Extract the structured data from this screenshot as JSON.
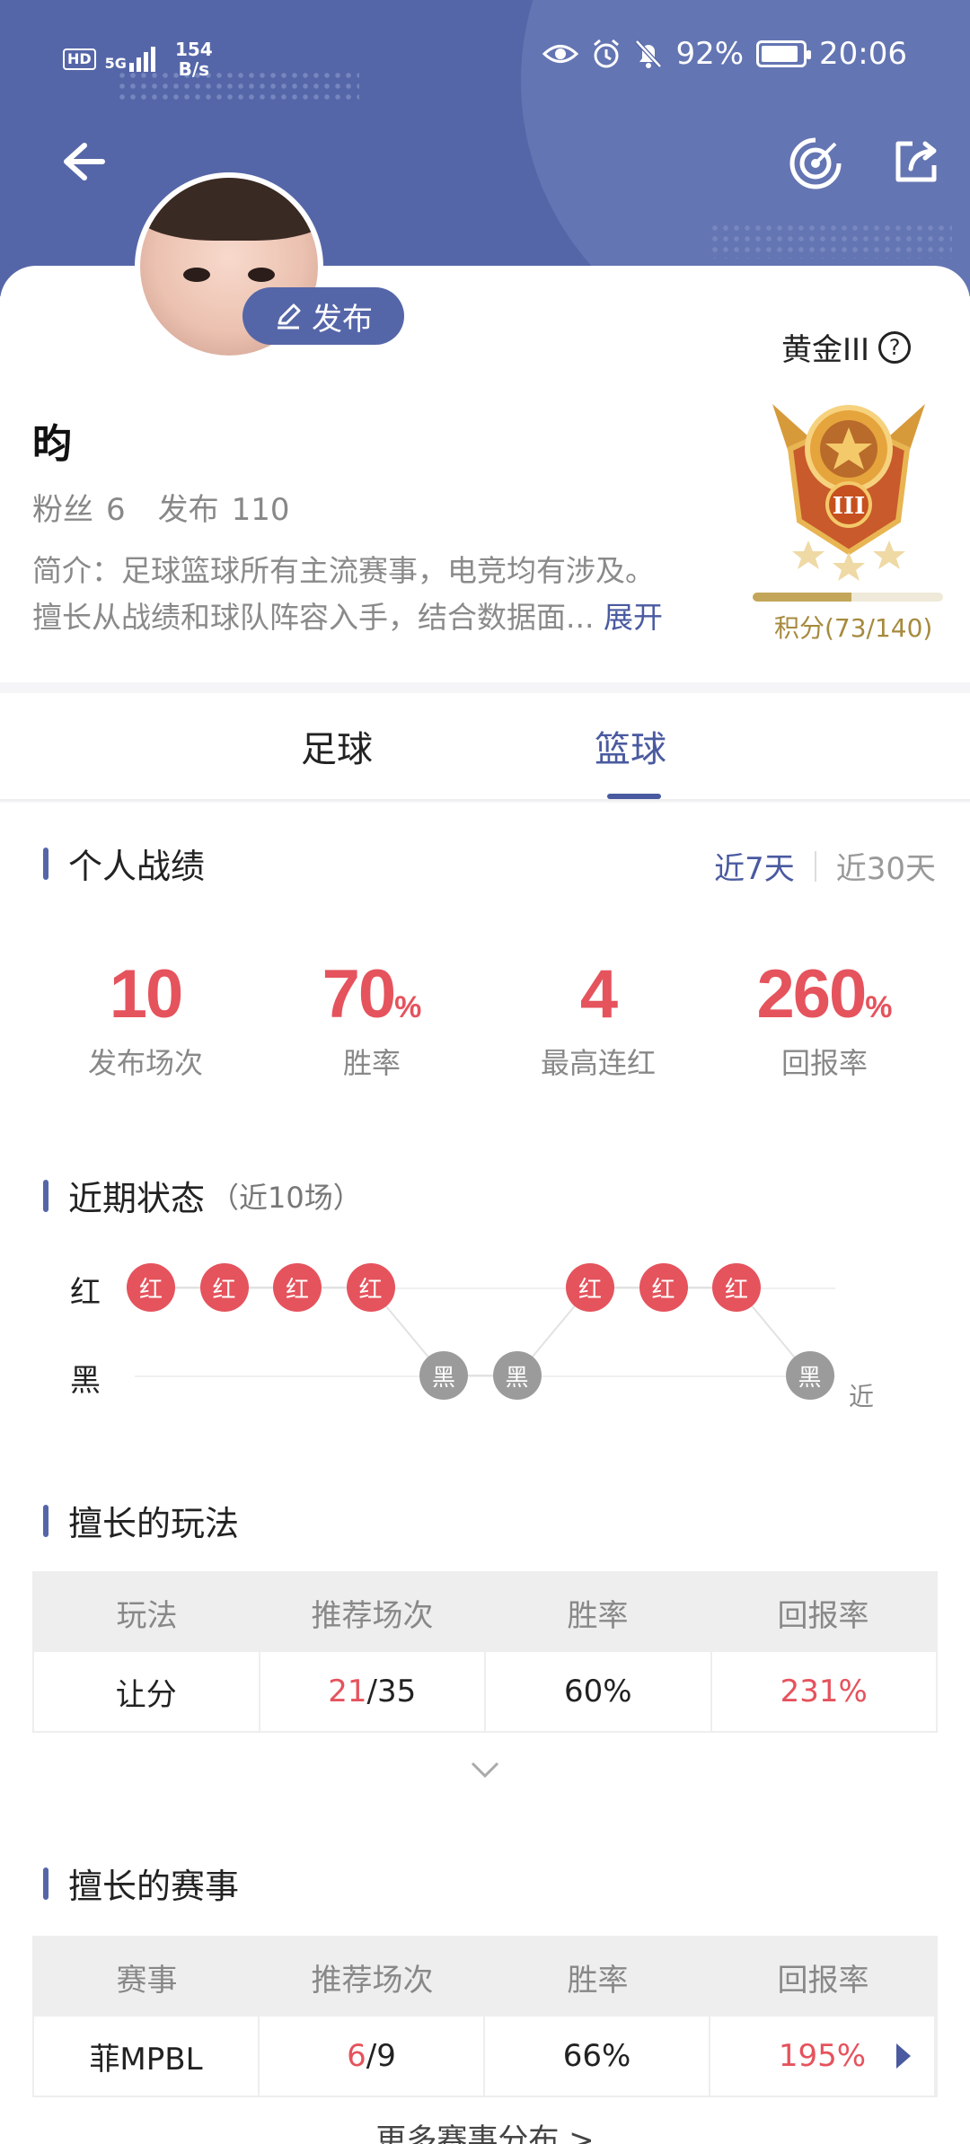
{
  "status_bar": {
    "network_left": "HD",
    "signal": "5G",
    "speed_value": "154",
    "speed_unit": "B/s",
    "battery_percent": "92%",
    "battery_level": 0.92,
    "time": "20:06"
  },
  "profile": {
    "publish_label": "发布",
    "name": "昀",
    "fans_label": "粉丝",
    "fans_count": "6",
    "posts_label": "发布",
    "posts_count": "110",
    "intro_line1": "简介：足球篮球所有主流赛事，电竞均有涉及。",
    "intro_line2": "擅长从战绩和球队阵容入手，结合数据面...",
    "expand_label": "展开",
    "rank_title": "黄金III",
    "help_icon": "?",
    "medal_numeral": "III",
    "score_text": "积分(73/140)",
    "score_fraction": 0.52
  },
  "tabs": [
    {
      "label": "足球"
    },
    {
      "label": "篮球"
    }
  ],
  "record": {
    "title": "个人战绩",
    "range_7": "近7天",
    "range_30": "近30天",
    "metrics": [
      {
        "value": "10",
        "unit": "",
        "label": "发布场次"
      },
      {
        "value": "70",
        "unit": "%",
        "label": "胜率"
      },
      {
        "value": "4",
        "unit": "",
        "label": "最高连红"
      },
      {
        "value": "260",
        "unit": "%",
        "label": "回报率"
      }
    ]
  },
  "recent": {
    "title": "近期状态",
    "subtitle": "（近10场）",
    "row_red": "红",
    "row_black": "黑",
    "near_label": "近",
    "results": [
      "红",
      "红",
      "红",
      "红",
      "黑",
      "黑",
      "红",
      "红",
      "红",
      "黑"
    ]
  },
  "plays": {
    "title": "擅长的玩法",
    "headers": [
      "玩法",
      "推荐场次",
      "胜率",
      "回报率"
    ],
    "rows": [
      {
        "name": "让分",
        "wins": "21",
        "total": "/35",
        "rate": "60%",
        "return": "231%"
      }
    ]
  },
  "events": {
    "title": "擅长的赛事",
    "headers": [
      "赛事",
      "推荐场次",
      "胜率",
      "回报率"
    ],
    "rows": [
      {
        "name": "菲MPBL",
        "wins": "6",
        "total": "/9",
        "rate": "66%",
        "return": "195%"
      }
    ],
    "more_link": "更多赛事分布 >"
  },
  "colors": {
    "brand": "#5566a8",
    "red": "#e5535d",
    "black_result": "#9b9b9b",
    "gold": "#c3a659"
  }
}
